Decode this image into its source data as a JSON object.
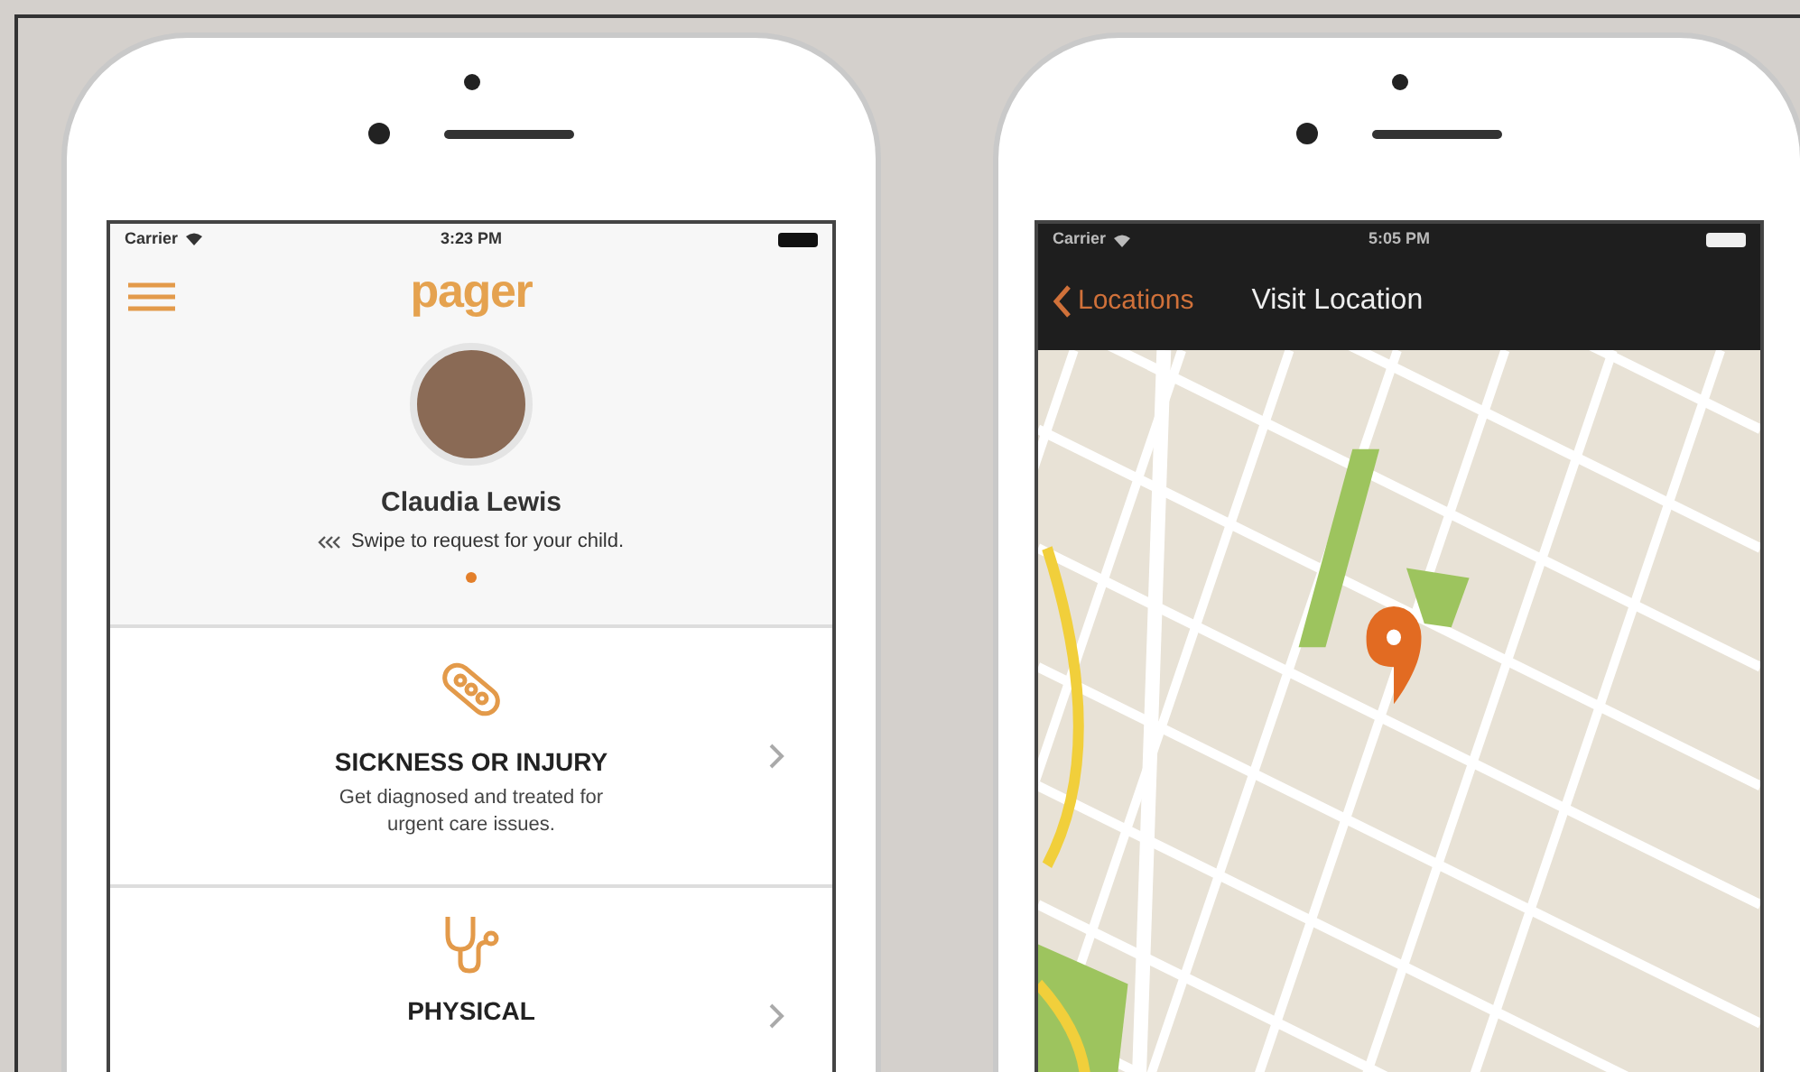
{
  "phones": [
    {
      "kind": "home",
      "status": {
        "carrier": "Carrier",
        "time": "3:23 PM"
      },
      "logo": "pager",
      "profile": {
        "name": "Claudia Lewis",
        "hint": "Swipe to request for your child."
      },
      "services": [
        {
          "title": "SICKNESS OR INJURY",
          "description": "Get diagnosed and treated for urgent care issues."
        },
        {
          "title": "PHYSICAL"
        }
      ]
    },
    {
      "kind": "map",
      "status": {
        "carrier": "Carrier",
        "time": "5:05 PM"
      },
      "nav": {
        "back": "Locations",
        "title": "Visit Location"
      }
    }
  ]
}
